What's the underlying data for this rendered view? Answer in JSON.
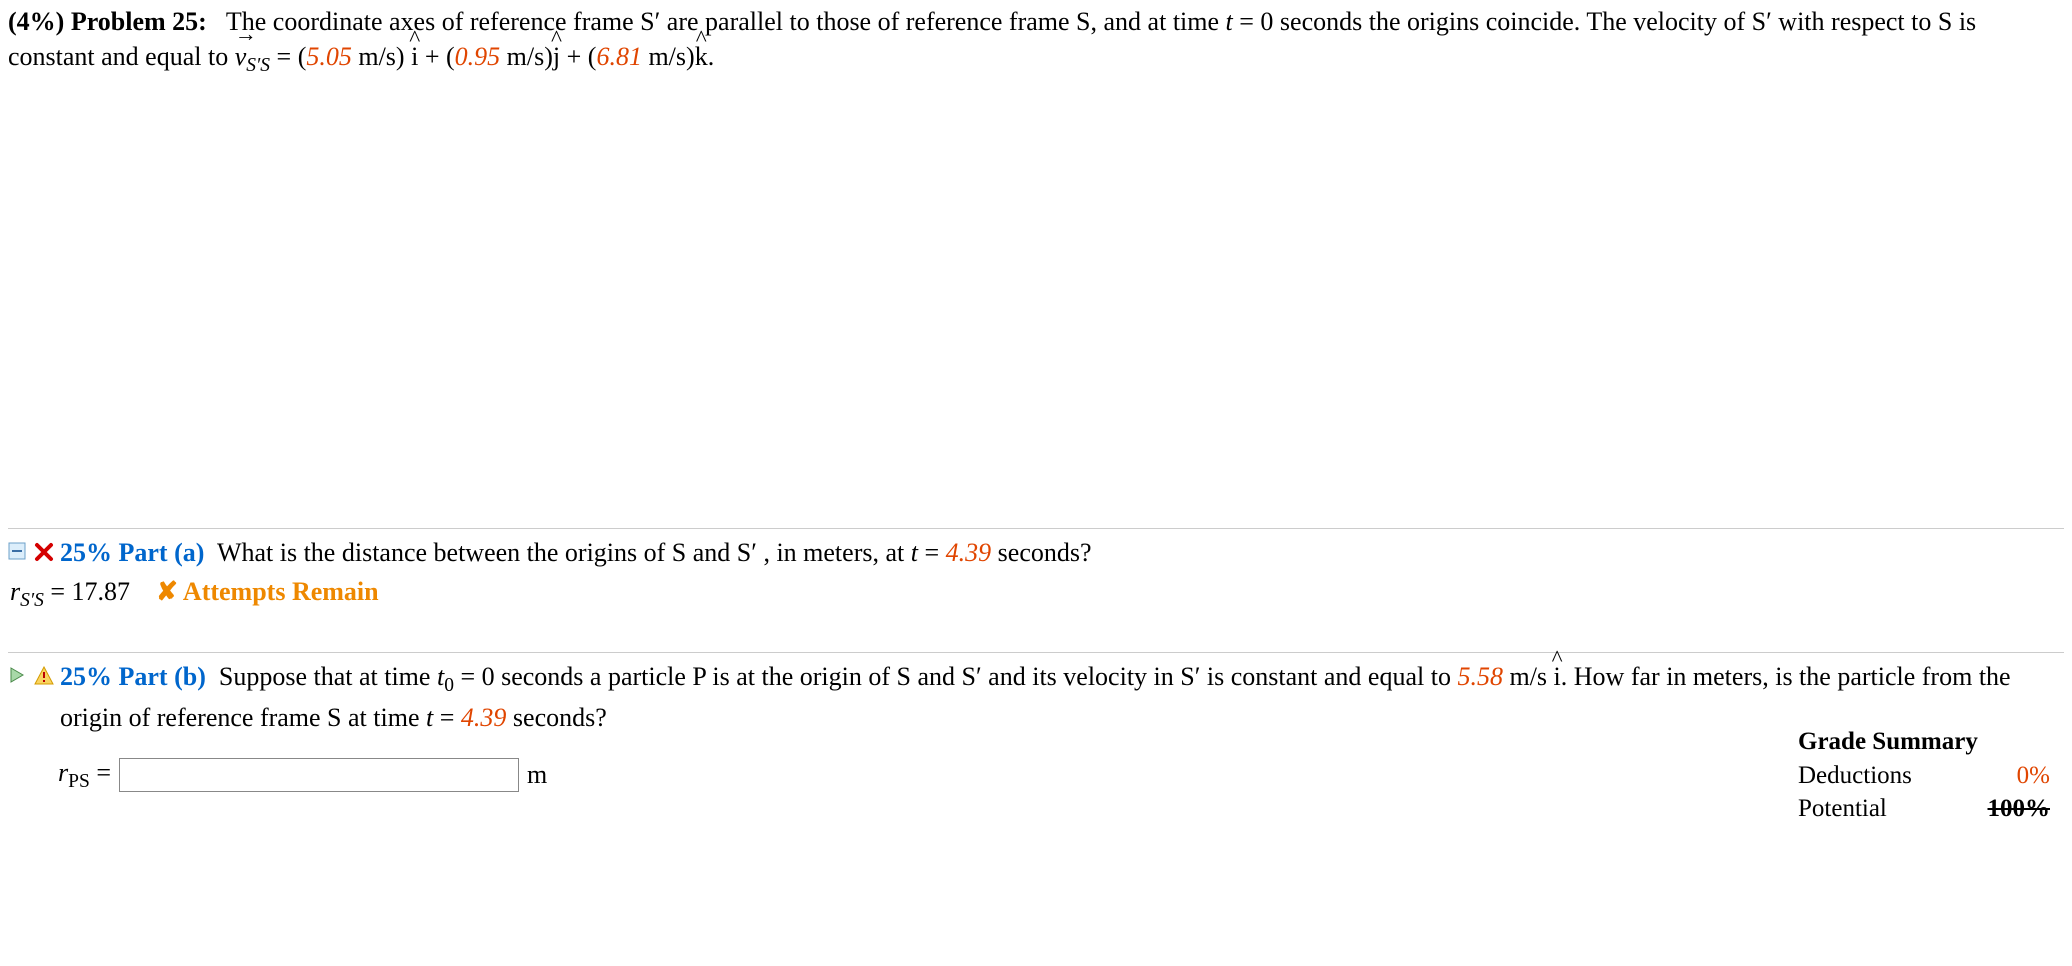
{
  "problem": {
    "percent": "(4%)",
    "label": "Problem 25:",
    "text_before_v": "The coordinate axes of reference frame S′ are parallel to those of reference frame S, and at time ",
    "t_eq": "t",
    "t_val": " = 0 seconds the origins coincide. The velocity of S′ with respect to S is constant and equal to ",
    "v_sub": "S′S",
    "eq_sign": " = (",
    "vx": "5.05",
    "vx_unit": " m/s) ",
    "plus1": " + (",
    "vy": "0.95",
    "vy_unit": " m/s)",
    "plus2": " + (",
    "vz": "6.81",
    "vz_unit": " m/s)",
    "period": "."
  },
  "part_a": {
    "pct": "25%",
    "label": "Part (a)",
    "question_before_t": "What is the distance between the origins of S and S′ , in meters, at ",
    "t_label": "t",
    "t_eq": " = ",
    "t_val": "4.39",
    "t_after": " seconds?",
    "status_var": "r",
    "status_sub": "S′S",
    "status_eq": " = 17.87",
    "attempts": "✘ Attempts Remain"
  },
  "part_b": {
    "pct": "25%",
    "label": "Part (b)",
    "q1": "Suppose that at time ",
    "t0": "t",
    "t0_sub": "0",
    "t0_eq": " = 0 seconds a particle P is at the origin of S and S′ and its velocity in S′ is constant and equal to ",
    "vel": "5.58",
    "vel_after": " m/s ",
    "q2": ". How far in meters, is the particle from the origin of reference frame S at time ",
    "t_label": "t",
    "t_eq": " = ",
    "t_val": "4.39",
    "t_after": " seconds?",
    "answer_var": "r",
    "answer_sub": "PS",
    "answer_eq": " = ",
    "unit": "m"
  },
  "grade": {
    "title": "Grade Summary",
    "deductions_label": "Deductions",
    "deductions_val": "0%",
    "potential_label": "Potential",
    "potential_val": "100%"
  }
}
